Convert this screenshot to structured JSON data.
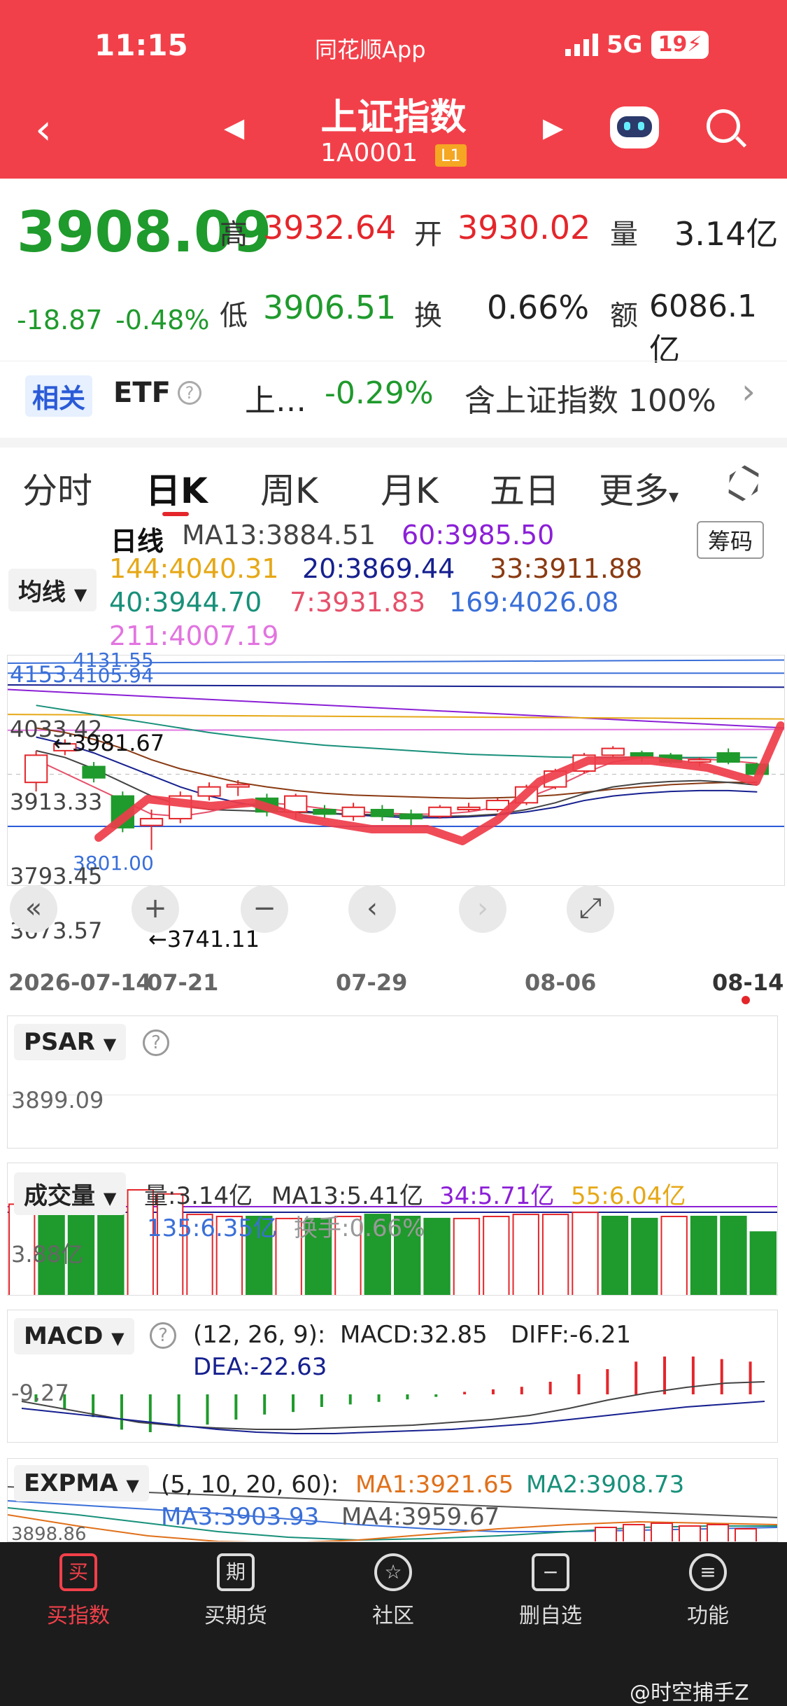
{
  "status": {
    "time": "11:15",
    "app": "同花顺App",
    "network": "5G",
    "battery": "19"
  },
  "header": {
    "title": "上证指数",
    "code": "1A0001",
    "level": "L1"
  },
  "quote": {
    "price": "3908.09",
    "change": "-18.87",
    "change_pct": "-0.48%",
    "high_label": "高",
    "high": "3932.64",
    "open_label": "开",
    "open": "3930.02",
    "volume_label": "量",
    "volume": "3.14亿",
    "low_label": "低",
    "low": "3906.51",
    "turnover_label": "换",
    "turnover": "0.66%",
    "amount_label": "额",
    "amount": "6086.1亿"
  },
  "related": {
    "tag": "相关",
    "type": "ETF",
    "name": "上…",
    "pct": "-0.29%",
    "desc": "含上证指数 100%"
  },
  "tabs": [
    "分时",
    "日K",
    "周K",
    "月K",
    "五日",
    "更多"
  ],
  "ma": {
    "select": "均线",
    "line": "日线",
    "chip_button": "筹码",
    "items": [
      {
        "label": "MA13:3884.51",
        "color": "#444444"
      },
      {
        "label": "60:3985.50",
        "color": "#8b1fd6"
      },
      {
        "label": "144:4040.31",
        "color": "#e6a817"
      },
      {
        "label": "20:3869.44",
        "color": "#16208f"
      },
      {
        "label": "33:3911.88",
        "color": "#8a3a12"
      },
      {
        "label": "40:3944.70",
        "color": "#18907a"
      },
      {
        "label": "7:3931.83",
        "color": "#e5506a"
      },
      {
        "label": "169:4026.08",
        "color": "#3a6fd8"
      },
      {
        "label": "211:4007.19",
        "color": "#e274e0"
      }
    ]
  },
  "kline": {
    "y_labels": [
      "4153.",
      "4131.55",
      "4105.94",
      "4033.42",
      "3913.33",
      "3793.45",
      "3801.00",
      "3673.57"
    ],
    "marks": [
      "←3981.67",
      "←3741.11"
    ],
    "x_labels": [
      "2026-07-14",
      "07-21",
      "07-29",
      "08-06",
      "08-14"
    ],
    "candles": [
      {
        "o": 3890,
        "c": 3950,
        "h": 3960,
        "l": 3870
      },
      {
        "o": 3960,
        "c": 3975,
        "h": 3985,
        "l": 3950
      },
      {
        "o": 3925,
        "c": 3900,
        "h": 3935,
        "l": 3890
      },
      {
        "o": 3860,
        "c": 3790,
        "h": 3870,
        "l": 3780
      },
      {
        "o": 3795,
        "c": 3810,
        "h": 3830,
        "l": 3741
      },
      {
        "o": 3810,
        "c": 3860,
        "h": 3870,
        "l": 3800
      },
      {
        "o": 3860,
        "c": 3880,
        "h": 3890,
        "l": 3850
      },
      {
        "o": 3880,
        "c": 3885,
        "h": 3895,
        "l": 3860
      },
      {
        "o": 3855,
        "c": 3825,
        "h": 3865,
        "l": 3815
      },
      {
        "o": 3825,
        "c": 3860,
        "h": 3865,
        "l": 3810
      },
      {
        "o": 3830,
        "c": 3820,
        "h": 3840,
        "l": 3810
      },
      {
        "o": 3815,
        "c": 3835,
        "h": 3845,
        "l": 3805
      },
      {
        "o": 3830,
        "c": 3815,
        "h": 3840,
        "l": 3805
      },
      {
        "o": 3820,
        "c": 3810,
        "h": 3830,
        "l": 3790
      },
      {
        "o": 3815,
        "c": 3835,
        "h": 3840,
        "l": 3810
      },
      {
        "o": 3830,
        "c": 3835,
        "h": 3845,
        "l": 3825
      },
      {
        "o": 3830,
        "c": 3850,
        "h": 3855,
        "l": 3825
      },
      {
        "o": 3845,
        "c": 3880,
        "h": 3885,
        "l": 3840
      },
      {
        "o": 3880,
        "c": 3915,
        "h": 3920,
        "l": 3875
      },
      {
        "o": 3915,
        "c": 3950,
        "h": 3955,
        "l": 3910
      },
      {
        "o": 3950,
        "c": 3965,
        "h": 3970,
        "l": 3945
      },
      {
        "o": 3955,
        "c": 3945,
        "h": 3960,
        "l": 3935
      },
      {
        "o": 3950,
        "c": 3935,
        "h": 3955,
        "l": 3930
      },
      {
        "o": 3935,
        "c": 3940,
        "h": 3945,
        "l": 3925
      },
      {
        "o": 3955,
        "c": 3935,
        "h": 3965,
        "l": 3930
      },
      {
        "o": 3930,
        "c": 3908,
        "h": 3933,
        "l": 3906
      }
    ]
  },
  "psar": {
    "label": "PSAR",
    "value": "3899.09"
  },
  "vol": {
    "label": "成交量",
    "v": "量:3.14亿",
    "ma13": "MA13:5.41亿",
    "ma34": "34:5.71亿",
    "ma55": "55:6.04亿",
    "ma135": "135:6.35亿",
    "turn": "换手:0.66%",
    "axis": "3.88亿",
    "bars": [
      {
        "v": 4.5,
        "up": true
      },
      {
        "v": 4.2,
        "up": false
      },
      {
        "v": 4.1,
        "up": false
      },
      {
        "v": 4.4,
        "up": false
      },
      {
        "v": 5.2,
        "up": true
      },
      {
        "v": 5.0,
        "up": true
      },
      {
        "v": 4.0,
        "up": true
      },
      {
        "v": 3.9,
        "up": true
      },
      {
        "v": 3.9,
        "up": false
      },
      {
        "v": 3.8,
        "up": true
      },
      {
        "v": 3.8,
        "up": false
      },
      {
        "v": 3.9,
        "up": true
      },
      {
        "v": 4.0,
        "up": false
      },
      {
        "v": 3.9,
        "up": false
      },
      {
        "v": 3.8,
        "up": false
      },
      {
        "v": 3.8,
        "up": true
      },
      {
        "v": 3.9,
        "up": true
      },
      {
        "v": 4.0,
        "up": true
      },
      {
        "v": 4.0,
        "up": true
      },
      {
        "v": 4.1,
        "up": true
      },
      {
        "v": 3.9,
        "up": false
      },
      {
        "v": 3.8,
        "up": false
      },
      {
        "v": 3.9,
        "up": true
      },
      {
        "v": 3.9,
        "up": false
      },
      {
        "v": 3.9,
        "up": false
      },
      {
        "v": 3.14,
        "up": false
      }
    ]
  },
  "macd": {
    "label": "MACD",
    "params": "(12, 26, 9):",
    "macd": "MACD:32.85",
    "diff": "DIFF:-6.21",
    "dea": "DEA:-22.63",
    "axis": "-9.27",
    "hist": [
      -6,
      -12,
      -18,
      -28,
      -30,
      -26,
      -24,
      -20,
      -16,
      -14,
      -10,
      -8,
      -6,
      -4,
      -2,
      2,
      4,
      6,
      10,
      16,
      20,
      26,
      30,
      30,
      28,
      26
    ]
  },
  "expma": {
    "label": "EXPMA",
    "params": "(5, 10, 20, 60):",
    "ma1": "MA1:3921.65",
    "ma2": "MA2:3908.73",
    "ma3": "MA3:3903.93",
    "ma4": "MA4:3959.67",
    "axis": "3898.86"
  },
  "nav": [
    {
      "label": "买指数",
      "icon": "买"
    },
    {
      "label": "买期货",
      "icon": "期"
    },
    {
      "label": "社区",
      "icon": "☆"
    },
    {
      "label": "删自选",
      "icon": "−"
    },
    {
      "label": "功能",
      "icon": "≡"
    }
  ],
  "watermark": "@时空捕手Z"
}
